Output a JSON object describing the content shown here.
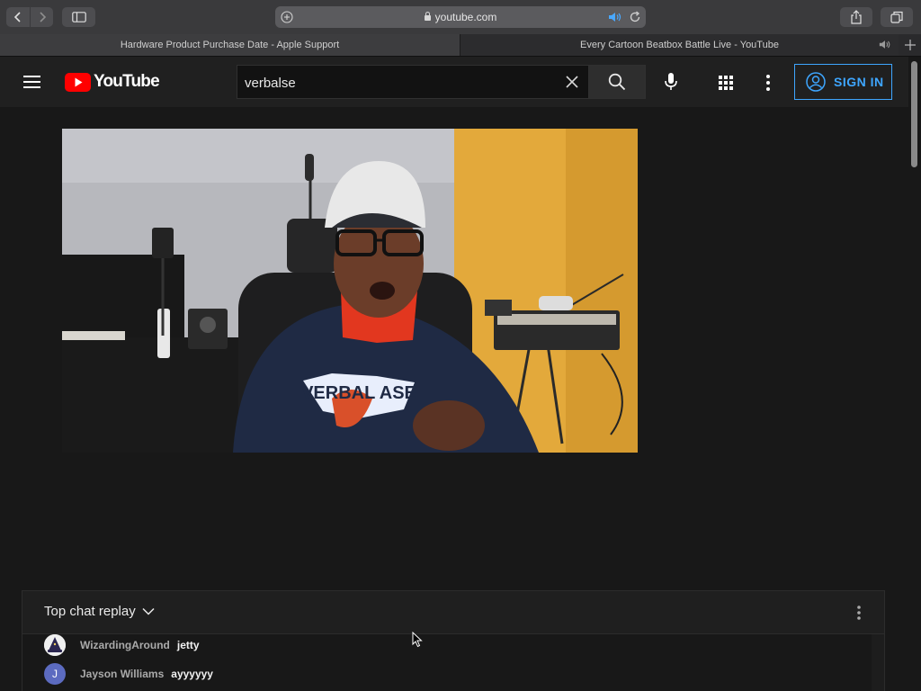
{
  "browser": {
    "url": "youtube.com",
    "tabs": [
      {
        "title": "Hardware Product Purchase Date - Apple Support"
      },
      {
        "title": "Every Cartoon Beatbox Battle Live - YouTube"
      }
    ],
    "icons": [
      "back-icon",
      "forward-icon",
      "sidebar-icon",
      "add-icon",
      "lock-icon",
      "speaker-icon",
      "reload-icon",
      "share-icon",
      "tabs-icon"
    ]
  },
  "youtube": {
    "logo_text": "YouTube",
    "search": {
      "value": "verbalse",
      "placeholder": "Search"
    },
    "signin_label": "SIGN IN",
    "brand_color": "#ff0000",
    "accent_color": "#3ea6ff"
  },
  "video": {
    "shirt_text": "VERBAL ASE"
  },
  "chat": {
    "mode_label": "Top chat replay",
    "messages": [
      {
        "author": "WizardingAround",
        "text": "jetty",
        "avatar": "wizard-hat"
      },
      {
        "author": "Jayson Williams",
        "text": "ayyyyyy",
        "avatar_letter": "J",
        "avatar_color": "#5c6bc0"
      }
    ]
  }
}
